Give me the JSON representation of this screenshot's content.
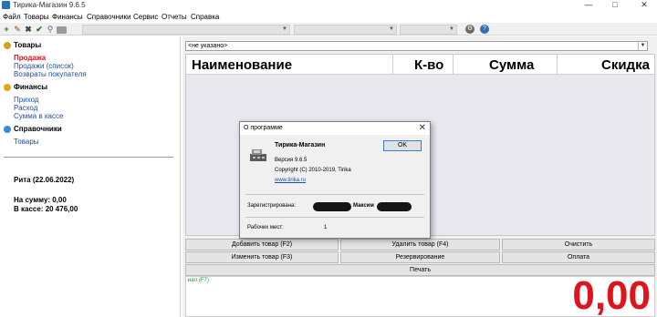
{
  "window": {
    "title": "Тирика-Магазин 9.6.5",
    "controls": [
      "—",
      "□",
      "✕"
    ]
  },
  "menu": [
    "Файл",
    "Товары",
    "Финансы",
    "Справочники",
    "Сервис",
    "Отчеты",
    "Справка"
  ],
  "toolbar": {
    "icons": [
      "plus-icon",
      "edit-icon",
      "delete-icon",
      "confirm-icon",
      "search-icon",
      "print-icon"
    ],
    "right_icons": [
      "gear-icon",
      "help-icon"
    ]
  },
  "sidebar": {
    "goods": {
      "title": "Товары",
      "items": [
        "Продажа",
        "Продажи (список)",
        "Возвраты покупателя"
      ]
    },
    "finance": {
      "title": "Финансы",
      "items": [
        "Приход",
        "Расход",
        "Сумма в кассе"
      ]
    },
    "refs": {
      "title": "Справочники",
      "items": [
        "Товары"
      ]
    },
    "info": {
      "user_date": "Рита (22.06.2022)",
      "sum": "На сумму: 0,00",
      "cash": "В кассе: 20 476,00"
    }
  },
  "main": {
    "customer_value": "<не указано>",
    "columns": [
      "Наименование",
      "К-во",
      "Сумма",
      "Скидка"
    ],
    "buttons": {
      "add": "Добавить товар (F2)",
      "remove": "Удалить товар (F4)",
      "clear": "Очистить",
      "edit": "Изменить товар (F3)",
      "reserve": "Резервирование",
      "pay": "Оплата",
      "print": "Печать"
    },
    "total_label": "нал (F7)",
    "total_value": "0,00"
  },
  "dialog": {
    "title": "О программе",
    "close": "✕",
    "product": "Тирика-Магазин",
    "version": "Версия 9.6.5",
    "copyright": "Copyright (C) 2010-2019, Tirika",
    "link": "www.tirika.ru",
    "ok": "OK",
    "registered_label": "Зарегистрирована:",
    "registered_name": "Максим",
    "seats_label": "Рабочих мест:",
    "seats_value": "1"
  },
  "colors": {
    "accent_red": "#e0141c",
    "link_blue": "#1e50a2",
    "panel_grey": "#f0f0f0"
  }
}
